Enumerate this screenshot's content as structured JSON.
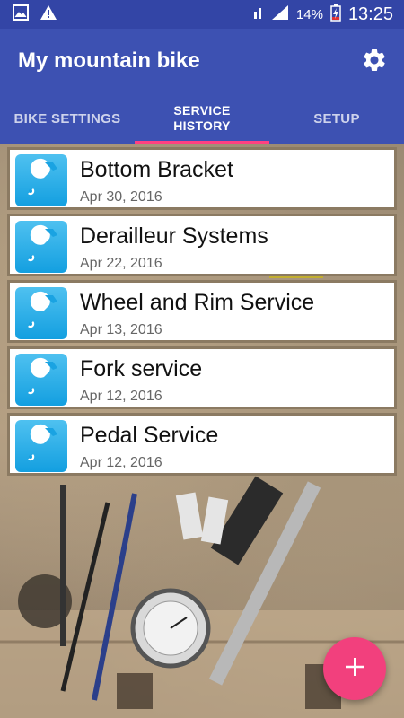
{
  "status_bar": {
    "battery_percent": "14%",
    "time": "13:25",
    "icons": [
      "image-notification-icon",
      "warning-icon",
      "wifi-icon",
      "signal-icon",
      "battery-charging-icon"
    ]
  },
  "app_bar": {
    "title": "My mountain bike",
    "settings_icon": "gear-icon"
  },
  "tabs": [
    {
      "label": "BIKE SETTINGS",
      "active": false
    },
    {
      "label": "SERVICE HISTORY",
      "active": true
    },
    {
      "label": "SETUP",
      "active": false
    }
  ],
  "services": [
    {
      "title": "Bottom Bracket",
      "date": "Apr 30, 2016",
      "icon": "wrench-icon"
    },
    {
      "title": "Derailleur Systems",
      "date": "Apr 22, 2016",
      "icon": "wrench-icon"
    },
    {
      "title": "Wheel and Rim Service",
      "date": "Apr 13, 2016",
      "icon": "wrench-icon"
    },
    {
      "title": "Fork service",
      "date": "Apr 12, 2016",
      "icon": "wrench-icon"
    },
    {
      "title": "Pedal Service",
      "date": "Apr 12, 2016",
      "icon": "wrench-icon"
    }
  ],
  "fab": {
    "icon": "plus-icon"
  },
  "colors": {
    "primary": "#3d51b2",
    "status_bar": "#3345a6",
    "accent": "#ff4081",
    "fab": "#f2407d",
    "icon_tile": "#139fe0"
  }
}
